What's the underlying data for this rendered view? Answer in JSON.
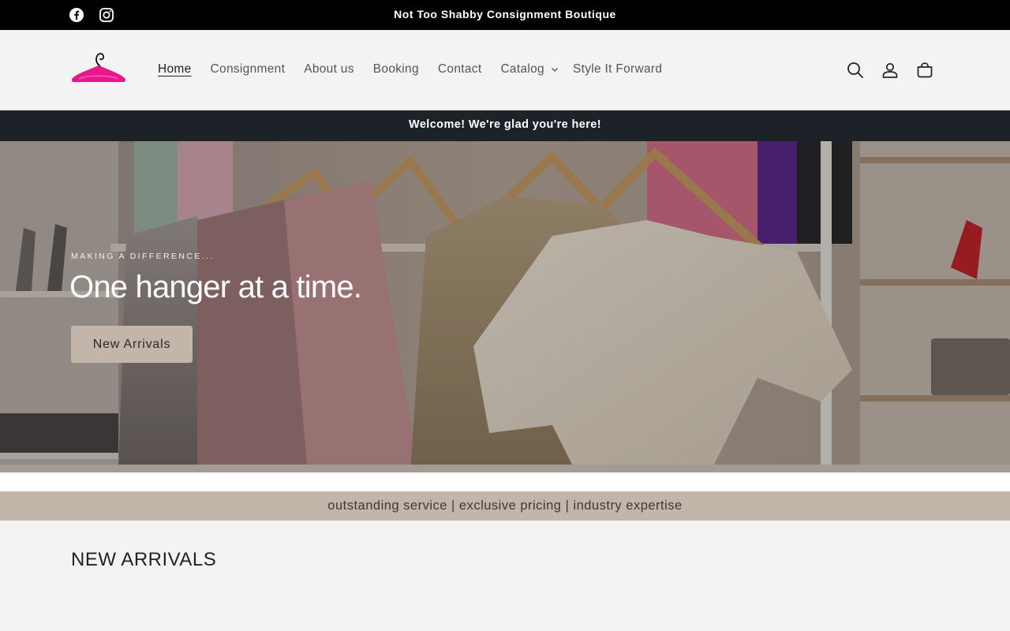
{
  "topbar": {
    "social": [
      "facebook-icon",
      "instagram-icon"
    ],
    "announcement": "Not Too Shabby Consignment Boutique"
  },
  "header": {
    "logo": "hanger-logo",
    "nav": [
      {
        "label": "Home",
        "active": true
      },
      {
        "label": "Consignment"
      },
      {
        "label": "About us"
      },
      {
        "label": "Booking"
      },
      {
        "label": "Contact"
      },
      {
        "label": "Catalog",
        "dropdown": true
      },
      {
        "label": "Style It Forward"
      }
    ],
    "icons": [
      "search-icon",
      "account-icon",
      "cart-icon"
    ]
  },
  "welcome": "Welcome! We're glad you're here!",
  "hero": {
    "eyebrow": "MAKING A DIFFERENCE...",
    "title": "One hanger at a time.",
    "button": "New Arrivals"
  },
  "tagline": "outstanding service | exclusive pricing | industry expertise",
  "section": {
    "title": "NEW ARRIVALS"
  },
  "colors": {
    "topbar": "#000000",
    "welcome_bar": "#1d2228",
    "accent_taupe": "#c2b6ab",
    "logo_pink": "#e9168c",
    "page_bg": "#f3f3f3"
  }
}
